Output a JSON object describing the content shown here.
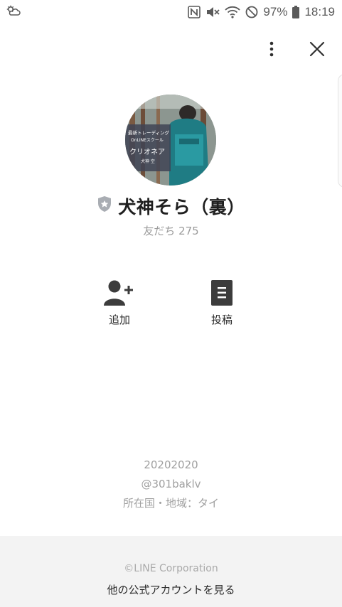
{
  "status_bar": {
    "battery": "97%",
    "time": "18:19",
    "icons": [
      "weather-cloud-icon",
      "nfc-icon",
      "mute-icon",
      "wifi-icon",
      "do-not-disturb-icon",
      "battery-icon"
    ]
  },
  "header": {
    "menu_icon": "more-vertical-icon",
    "close_icon": "close-icon"
  },
  "profile": {
    "avatar_text": {
      "line1": "最新トレーディング",
      "line2": "OnLINEスクール",
      "line3": "クリオネア",
      "line4": "犬神 空"
    },
    "name": "犬神そら（裏）",
    "friends_label": "友だち 275",
    "badge_icon": "official-shield-icon"
  },
  "actions": [
    {
      "label": "追加",
      "icon": "add-friend-icon"
    },
    {
      "label": "投稿",
      "icon": "posts-icon"
    }
  ],
  "info": {
    "date": "20202020",
    "line_id": "@301baklv",
    "location": "所在国・地域：タイ"
  },
  "footer": {
    "copyright": "©LINE Corporation",
    "link": "他の公式アカウントを見る"
  },
  "colors": {
    "background": "#ffffff",
    "footer_bg": "#f3f3f3",
    "icon_dark": "#3c3c3c",
    "muted_text": "#9b9b9b"
  }
}
